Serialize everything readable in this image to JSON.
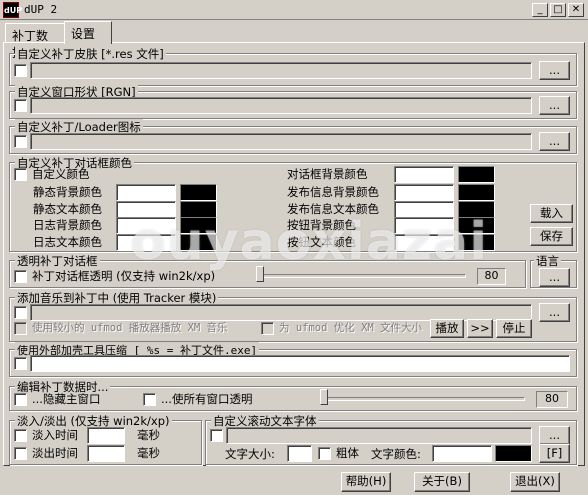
{
  "window": {
    "title": "dUP 2",
    "icon_text": "dUP"
  },
  "tabs": [
    {
      "label": "补丁数据"
    },
    {
      "label": "设置"
    }
  ],
  "groups": {
    "skin": {
      "title": "自定义补丁皮肤 [*.res 文件]",
      "browse": "..."
    },
    "region": {
      "title": "自定义窗口形状 [RGN]",
      "browse": "..."
    },
    "icon": {
      "title": "自定义补丁/Loader图标",
      "browse": "..."
    },
    "colors": {
      "title": "自定义补丁对话框颜色",
      "custom_label": "自定义颜色",
      "left_labels": [
        "静态背景颜色",
        "静态文本颜色",
        "日志背景颜色",
        "日志文本颜色"
      ],
      "right_labels": [
        "对话框背景颜色",
        "发布信息背景颜色",
        "发布信息文本颜色",
        "按钮背景颜色",
        "按钮文本颜色"
      ],
      "load_button": "载入",
      "save_button": "保存"
    },
    "transparency": {
      "title": "透明补丁对话框",
      "checkbox_label": "补丁对话框透明 (仅支持 win2k/xp)",
      "value": "80"
    },
    "language": {
      "title": "语言",
      "browse": "..."
    },
    "music": {
      "title": "添加音乐到补丁中 (使用 Tracker 模块)",
      "browse": "...",
      "small_player_label": "使用较小的 ufmod 播放器播放 XM 音乐",
      "optimize_label": "为 ufmod 优化 XM 文件大小",
      "play_button": "播放",
      "next_button": ">>",
      "stop_button": "停止"
    },
    "packer": {
      "title": "使用外部加壳工具压缩 [ %s = 补丁文件.exe]",
      "browse": "..."
    },
    "editing": {
      "title": "编辑补丁数据时...",
      "hide_main_label": "...隐藏主窗口",
      "transparent_all_label": "...使所有窗口透明",
      "value": "80"
    },
    "fade": {
      "title": "淡入/淡出 (仅支持 win2k/xp)",
      "fade_in_label": "淡入时间",
      "fade_out_label": "淡出时间",
      "unit": "毫秒"
    },
    "scroll_font": {
      "title": "自定义滚动文本字体",
      "browse": "...",
      "size_label": "文字大小:",
      "bold_label": "粗体",
      "color_label": "文字颜色:",
      "font_button": "[F]"
    }
  },
  "footer": {
    "help_button": "帮助(H)",
    "about_button": "关于(B)",
    "exit_button": "退出(X)"
  },
  "watermark": "ouyaoxiazai",
  "colors": {
    "dialog_bg": "#d4d0c8",
    "swatch_black": "#000000",
    "field_white": "#ffffff"
  }
}
